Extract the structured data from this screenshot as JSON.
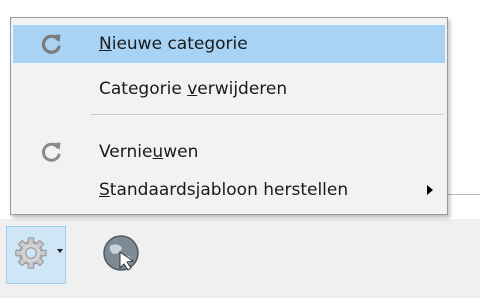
{
  "menu": {
    "items": [
      {
        "label_pre": "",
        "label_key": "N",
        "label_post": "ieuwe categorie",
        "icon": "refresh-icon",
        "highlighted": true
      },
      {
        "label_pre": "Categorie ",
        "label_key": "v",
        "label_post": "erwijderen",
        "highlighted": false
      },
      {
        "label_pre": "Vernie",
        "label_key": "u",
        "label_post": "wen",
        "icon": "refresh-icon",
        "highlighted": false
      },
      {
        "label_pre": "",
        "label_key": "S",
        "label_post": "tandaardsjabloon herstellen",
        "submenu": true,
        "highlighted": false
      }
    ]
  },
  "toolbar": {
    "settings_icon": "gear-icon",
    "dropdown_icon": "dropdown-arrow-icon",
    "globe_icon": "globe-icon"
  },
  "colors": {
    "menu_bg": "#f2f2f2",
    "highlight": "#a8d3f5",
    "toolbar_bg": "#f0f0f0",
    "gear_box": "#cfe6f7"
  }
}
